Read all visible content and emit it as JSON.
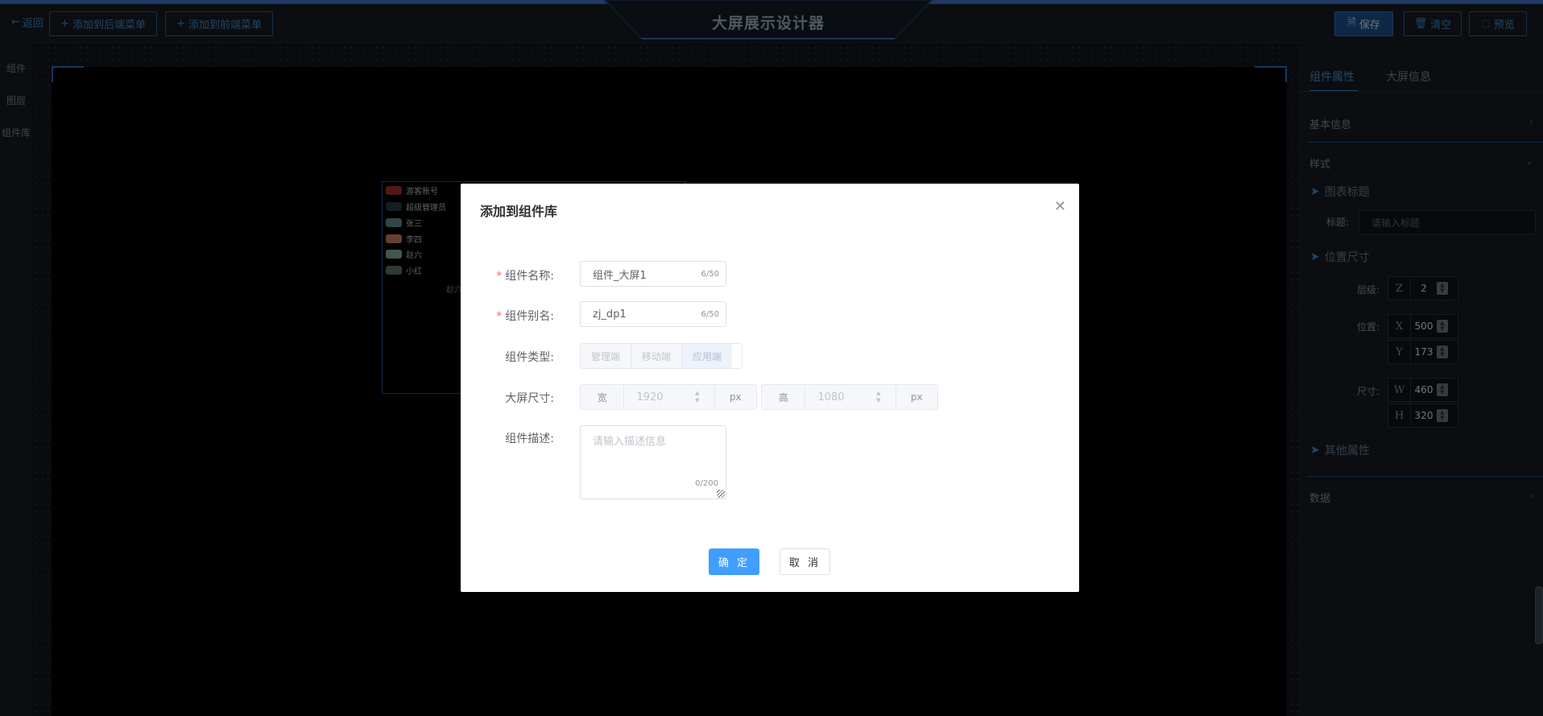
{
  "header": {
    "back_label": "返回",
    "add_back_menu_label": "添加到后端菜单",
    "add_front_menu_label": "添加到前端菜单",
    "title": "大屏展示设计器",
    "save_label": "保存",
    "clear_label": "清空",
    "preview_label": "预览"
  },
  "left_sidebar": {
    "items": [
      {
        "label": "组件"
      },
      {
        "label": "图层"
      },
      {
        "label": "组件库"
      }
    ]
  },
  "canvas": {
    "legend": [
      {
        "label": "游客账号",
        "color": "#a2302d"
      },
      {
        "label": "超级管理员",
        "color": "#2b3b47"
      },
      {
        "label": "张三",
        "color": "#5f8d90"
      },
      {
        "label": "李四",
        "color": "#cf7f63"
      },
      {
        "label": "赵六",
        "color": "#8aa999"
      },
      {
        "label": "小红",
        "color": "#5f7760"
      }
    ],
    "partial_label": "赵六"
  },
  "right_panel": {
    "tabs": [
      {
        "label": "组件属性",
        "active": true
      },
      {
        "label": "大屏信息",
        "active": false
      }
    ],
    "sections": {
      "basic_info": "基本信息",
      "style": "样式",
      "chart_title": "图表标题",
      "title_label": "标题:",
      "title_placeholder": "请输入标题",
      "position_size": "位置尺寸",
      "layer_label": "层级:",
      "layer_prefix": "Z",
      "layer_value": "2",
      "position_label": "位置:",
      "x_prefix": "X",
      "x_value": "500",
      "y_prefix": "Y",
      "y_value": "173",
      "size_label": "尺寸:",
      "w_prefix": "W",
      "w_value": "460",
      "h_prefix": "H",
      "h_value": "320",
      "other_props": "其他属性",
      "data": "数据"
    }
  },
  "dialog": {
    "title": "添加到组件库",
    "name_label": "组件名称:",
    "name_value": "组件_大屏1",
    "name_count": "6/50",
    "alias_label": "组件别名:",
    "alias_value": "zj_dp1",
    "alias_count": "6/50",
    "type_label": "组件类型:",
    "type_options": [
      "管理端",
      "移动端",
      "应用端"
    ],
    "size_label": "大屏尺寸:",
    "width_prefix": "宽",
    "width_value": "1920",
    "width_unit": "px",
    "height_prefix": "高",
    "height_value": "1080",
    "height_unit": "px",
    "desc_label": "组件描述:",
    "desc_placeholder": "请输入描述信息",
    "desc_count": "0/200",
    "ok_label": "确 定",
    "cancel_label": "取 消"
  },
  "colors": {
    "accent": "#409eff",
    "header_bg": "#171a21",
    "brand_blue": "#3d73c9"
  }
}
